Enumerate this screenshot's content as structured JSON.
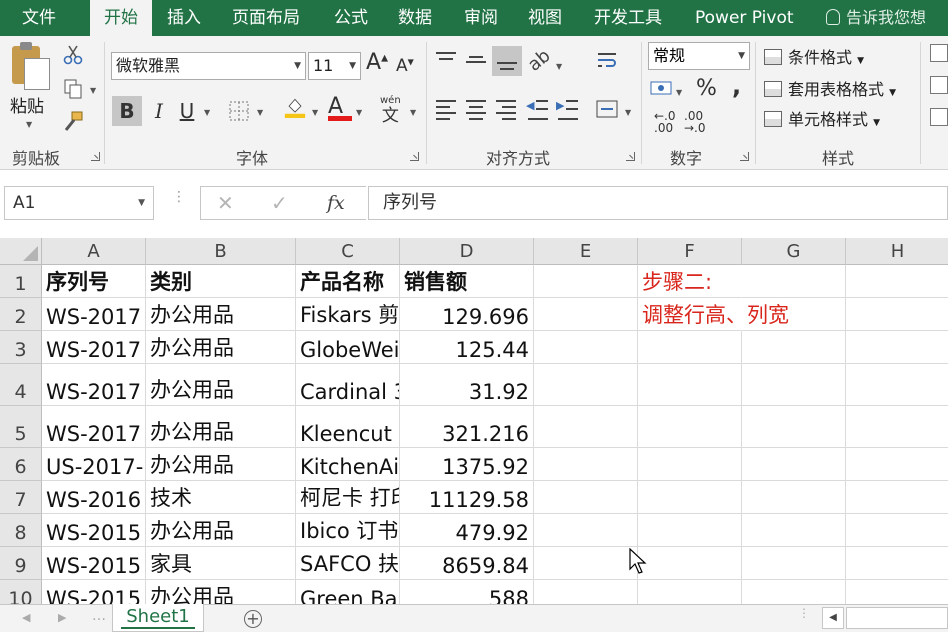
{
  "ribbon_tabs": [
    {
      "label": "文件"
    },
    {
      "label": "开始"
    },
    {
      "label": "插入"
    },
    {
      "label": "页面布局"
    },
    {
      "label": "公式"
    },
    {
      "label": "数据"
    },
    {
      "label": "审阅"
    },
    {
      "label": "视图"
    },
    {
      "label": "开发工具"
    },
    {
      "label": "Power Pivot"
    }
  ],
  "active_tab": "开始",
  "tell_me": "告诉我您想",
  "ribbon": {
    "paste_label": "粘贴",
    "clipboard_group": "剪贴板",
    "font_name": "微软雅黑",
    "font_size": "11",
    "font_group": "字体",
    "bold": "B",
    "italic": "I",
    "underline": "U",
    "grow_font": "A",
    "shrink_font": "A",
    "phonetic": "wén",
    "phonetic_char": "文",
    "alignment_group": "对齐方式",
    "number_format": "常规",
    "percent": "%",
    "comma": ",",
    "dec_increase": "←.0\n.00",
    "dec_decrease": ".00\n→.0",
    "number_group": "数字",
    "conditional_formatting": "条件格式",
    "format_as_table": "套用表格格式",
    "cell_styles": "单元格样式",
    "styles_group": "样式"
  },
  "formula_bar": {
    "name_box": "A1",
    "fx": "fx",
    "content": "序列号"
  },
  "columns": [
    "A",
    "B",
    "C",
    "D",
    "E",
    "F",
    "G",
    "H"
  ],
  "rows": [
    {
      "num": "1",
      "cells": [
        "序列号",
        "类别",
        "产品名称",
        "销售额",
        "",
        "步骤二:",
        "",
        ""
      ]
    },
    {
      "num": "2",
      "cells": [
        "WS-2017",
        "办公用品",
        "Fiskars 剪",
        "129.696",
        "",
        "调整行高、列宽",
        "",
        ""
      ]
    },
    {
      "num": "3",
      "cells": [
        "WS-2017",
        "办公用品",
        "GlobeWei",
        "125.44",
        "",
        "",
        "",
        ""
      ]
    },
    {
      "num": "4",
      "cells": [
        "WS-2017",
        "办公用品",
        "Cardinal 3",
        "31.92",
        "",
        "",
        "",
        ""
      ]
    },
    {
      "num": "5",
      "cells": [
        "WS-2017",
        "办公用品",
        "Kleencut",
        "321.216",
        "",
        "",
        "",
        ""
      ]
    },
    {
      "num": "6",
      "cells": [
        "US-2017-",
        "办公用品",
        "KitchenAi",
        "1375.92",
        "",
        "",
        "",
        ""
      ]
    },
    {
      "num": "7",
      "cells": [
        "WS-2016",
        "技术",
        "柯尼卡 打印",
        "11129.58",
        "",
        "",
        "",
        ""
      ]
    },
    {
      "num": "8",
      "cells": [
        "WS-2015",
        "办公用品",
        "Ibico 订书",
        "479.92",
        "",
        "",
        "",
        ""
      ]
    },
    {
      "num": "9",
      "cells": [
        "WS-2015",
        "家具",
        "SAFCO 扶",
        "8659.84",
        "",
        "",
        "",
        ""
      ]
    },
    {
      "num": "10",
      "cells": [
        "WS-2015",
        "办公用品",
        "Green Bar",
        "588",
        "",
        "",
        "",
        ""
      ]
    }
  ],
  "sheet_tabs": [
    {
      "label": "Sheet1"
    }
  ],
  "colors": {
    "brand": "#217346",
    "annotation": "#d9261c"
  }
}
